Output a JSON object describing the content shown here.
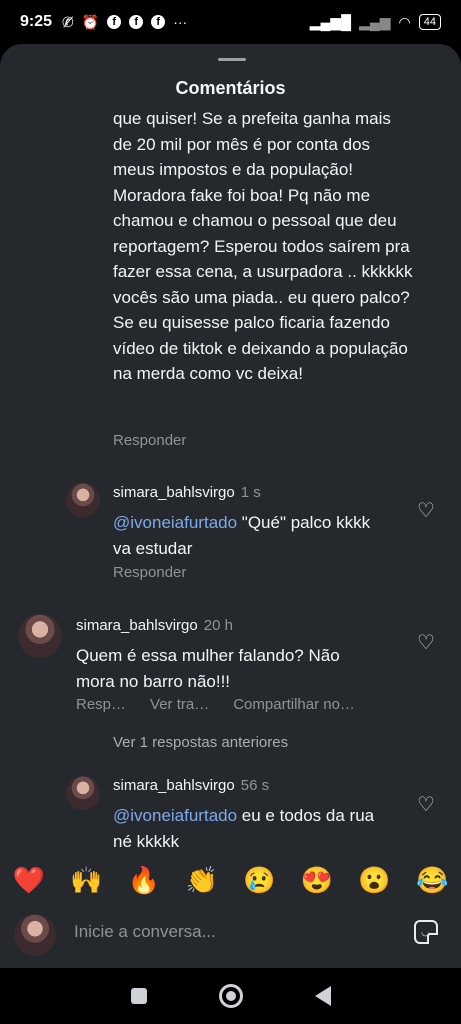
{
  "status_bar": {
    "time": "9:25",
    "battery": "44",
    "icons": [
      "no-call-icon",
      "alarm-icon",
      "facebook-icon",
      "facebook-icon",
      "facebook-icon",
      "more-icon",
      "signal-icon",
      "no-signal-icon",
      "wifi-icon",
      "battery-icon"
    ]
  },
  "sheet": {
    "title": "Comentários"
  },
  "main_comment": {
    "text": "que quiser! Se a prefeita ganha mais de 20 mil por mês é por conta dos meus impostos e da população! Moradora fake foi boa! Pq não me chamou e chamou o pessoal que deu reportagem? Esperou todos saírem pra fazer essa cena, a usurpadora .. kkkkkk vocês são uma piada.. eu quero palco? Se eu quisesse palco ficaria fazendo vídeo de tiktok e deixando a população na merda como vc deixa!",
    "reply_label": "Responder"
  },
  "reply_1": {
    "username": "simara_bahlsvirgo",
    "time": "1 s",
    "mention": "@ivoneiafurtado",
    "text": " \"Qué\" palco kkkk va estudar",
    "reply_label": "Responder"
  },
  "comment_2": {
    "username": "simara_bahlsvirgo",
    "time": "20 h",
    "text": "Quem é essa mulher falando? Não mora no barro não!!!",
    "actions": [
      "Resp…",
      "Ver tra…",
      "Compartilhar no…"
    ]
  },
  "view_more": "Ver 1 respostas anteriores",
  "reply_2": {
    "username": "simara_bahlsvirgo",
    "time": "56 s",
    "mention": "@ivoneiafurtado",
    "text": " eu e todos da rua né kkkkk"
  },
  "emoji_bar": [
    "❤️",
    "🙌",
    "🔥",
    "👏",
    "😢",
    "😍",
    "😮",
    "😂"
  ],
  "composer": {
    "placeholder": "Inicie a conversa..."
  },
  "navbar": {
    "icons": [
      "recents-icon",
      "home-icon",
      "back-icon"
    ]
  }
}
